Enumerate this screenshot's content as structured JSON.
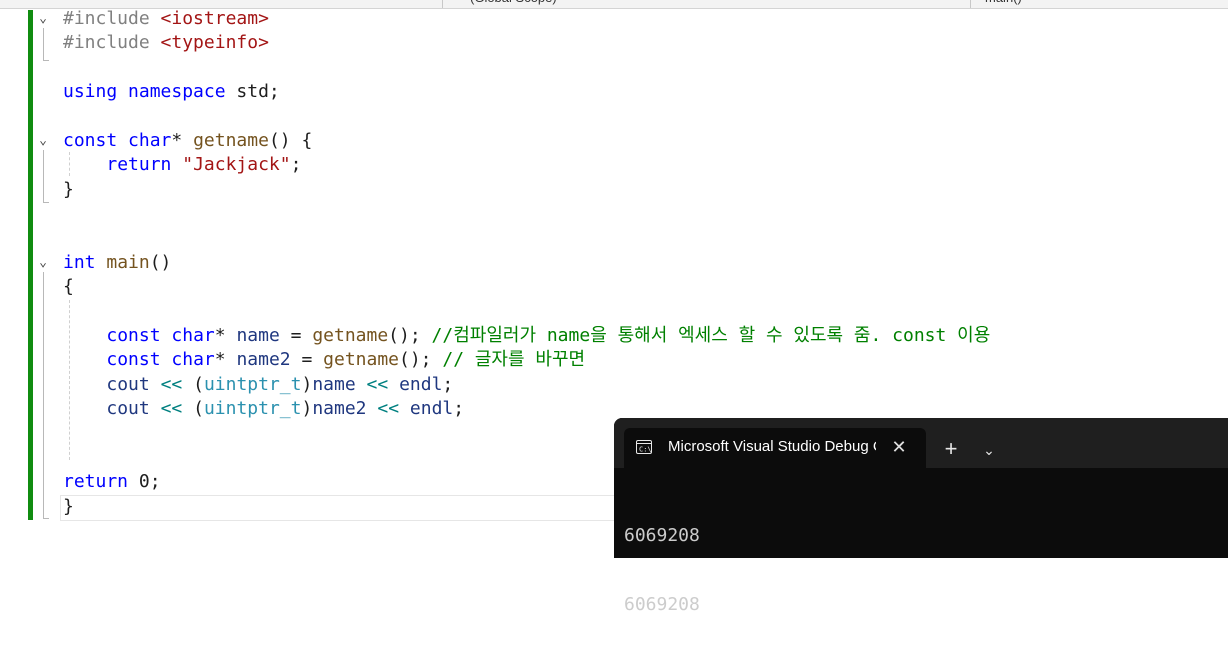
{
  "toolbar": {
    "scope_left": "(Global Scope)",
    "scope_right": "main()"
  },
  "editor": {
    "lines": [
      [
        {
          "t": "#include ",
          "c": "pp"
        },
        {
          "t": "<iostream>",
          "c": "inc"
        }
      ],
      [
        {
          "t": "#include ",
          "c": "pp"
        },
        {
          "t": "<typeinfo>",
          "c": "inc"
        }
      ],
      [],
      [
        {
          "t": "using",
          "c": "kw"
        },
        {
          "t": " "
        },
        {
          "t": "namespace",
          "c": "kw"
        },
        {
          "t": " std;"
        }
      ],
      [],
      [
        {
          "t": "const",
          "c": "kw"
        },
        {
          "t": " "
        },
        {
          "t": "char",
          "c": "kw"
        },
        {
          "t": "* "
        },
        {
          "t": "getname",
          "c": "fn"
        },
        {
          "t": "() {"
        }
      ],
      [
        {
          "t": "    "
        },
        {
          "t": "return",
          "c": "kw"
        },
        {
          "t": " "
        },
        {
          "t": "\"Jackjack\"",
          "c": "str"
        },
        {
          "t": ";"
        }
      ],
      [
        {
          "t": "}"
        }
      ],
      [],
      [],
      [
        {
          "t": "int",
          "c": "kw"
        },
        {
          "t": " "
        },
        {
          "t": "main",
          "c": "fn"
        },
        {
          "t": "()"
        }
      ],
      [
        {
          "t": "{"
        }
      ],
      [],
      [
        {
          "t": "    "
        },
        {
          "t": "const",
          "c": "kw"
        },
        {
          "t": " "
        },
        {
          "t": "char",
          "c": "kw"
        },
        {
          "t": "* "
        },
        {
          "t": "name",
          "c": "var"
        },
        {
          "t": " = "
        },
        {
          "t": "getname",
          "c": "fn"
        },
        {
          "t": "(); "
        },
        {
          "t": "//컴파일러가 name을 통해서 엑세스 할 수 있도록 줌. const 이용",
          "c": "cm"
        }
      ],
      [
        {
          "t": "    "
        },
        {
          "t": "const",
          "c": "kw"
        },
        {
          "t": " "
        },
        {
          "t": "char",
          "c": "kw"
        },
        {
          "t": "* "
        },
        {
          "t": "name2",
          "c": "var"
        },
        {
          "t": " = "
        },
        {
          "t": "getname",
          "c": "fn"
        },
        {
          "t": "(); "
        },
        {
          "t": "// 글자를 바꾸면",
          "c": "cm"
        }
      ],
      [
        {
          "t": "    "
        },
        {
          "t": "cout",
          "c": "var"
        },
        {
          "t": " "
        },
        {
          "t": "<<",
          "c": "op"
        },
        {
          "t": " ("
        },
        {
          "t": "uintptr_t",
          "c": "ty"
        },
        {
          "t": ")"
        },
        {
          "t": "name",
          "c": "var"
        },
        {
          "t": " "
        },
        {
          "t": "<<",
          "c": "op"
        },
        {
          "t": " "
        },
        {
          "t": "endl",
          "c": "var"
        },
        {
          "t": ";"
        }
      ],
      [
        {
          "t": "    "
        },
        {
          "t": "cout",
          "c": "var"
        },
        {
          "t": " "
        },
        {
          "t": "<<",
          "c": "op"
        },
        {
          "t": " ("
        },
        {
          "t": "uintptr_t",
          "c": "ty"
        },
        {
          "t": ")"
        },
        {
          "t": "name2",
          "c": "var"
        },
        {
          "t": " "
        },
        {
          "t": "<<",
          "c": "op"
        },
        {
          "t": " "
        },
        {
          "t": "endl",
          "c": "var"
        },
        {
          "t": ";"
        }
      ],
      [],
      [],
      [
        {
          "t": "return",
          "c": "kw"
        },
        {
          "t": " 0;"
        }
      ],
      [
        {
          "t": "}"
        }
      ]
    ]
  },
  "terminal": {
    "tab_title": "Microsoft Visual Studio Debug Console",
    "close_glyph": "✕",
    "new_tab_glyph": "+",
    "dropdown_glyph": "⌄",
    "output_lines": [
      "6069208",
      "6069208"
    ]
  },
  "colors": {
    "change_bar": "#108c10",
    "keyword": "#0000ff",
    "comment": "#008000",
    "string": "#a31515",
    "terminal_bg": "#0c0c0c"
  }
}
